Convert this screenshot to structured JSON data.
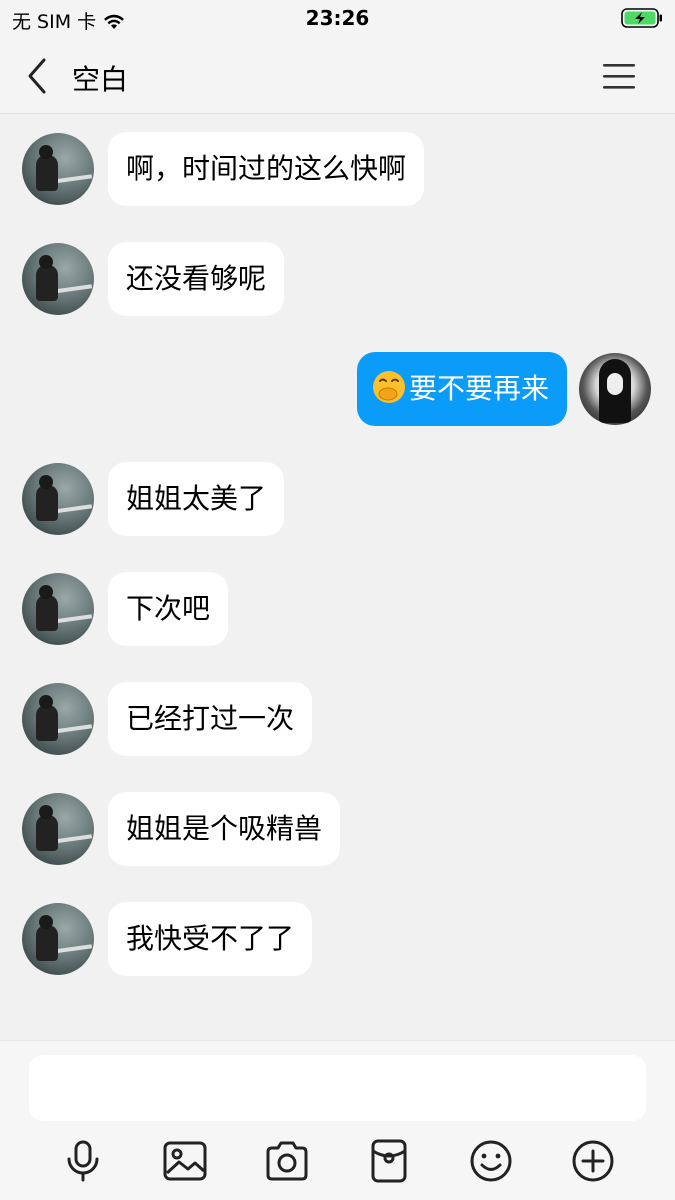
{
  "status_bar": {
    "carrier": "无 SIM 卡",
    "time": "23:26"
  },
  "header": {
    "title": "空白"
  },
  "messages": [
    {
      "text": "啊，时间过的这么快啊"
    },
    {
      "text": "还没看够呢"
    },
    {
      "text": "要不要再来",
      "emoji": "hand-over-mouth-emoji"
    },
    {
      "text": "姐姐太美了"
    },
    {
      "text": "下次吧"
    },
    {
      "text": "已经打过一次"
    },
    {
      "text": "姐姐是个吸精兽"
    },
    {
      "text": "我快受不了了"
    }
  ],
  "input": {
    "value": ""
  },
  "toolbar_icons": [
    "microphone-icon",
    "image-icon",
    "camera-icon",
    "red-packet-icon",
    "emoji-icon",
    "plus-icon"
  ],
  "colors": {
    "self_bubble": "#0a9cf8",
    "other_bubble": "#ffffff",
    "background": "#f1f1f1",
    "battery": "#4cd964"
  }
}
